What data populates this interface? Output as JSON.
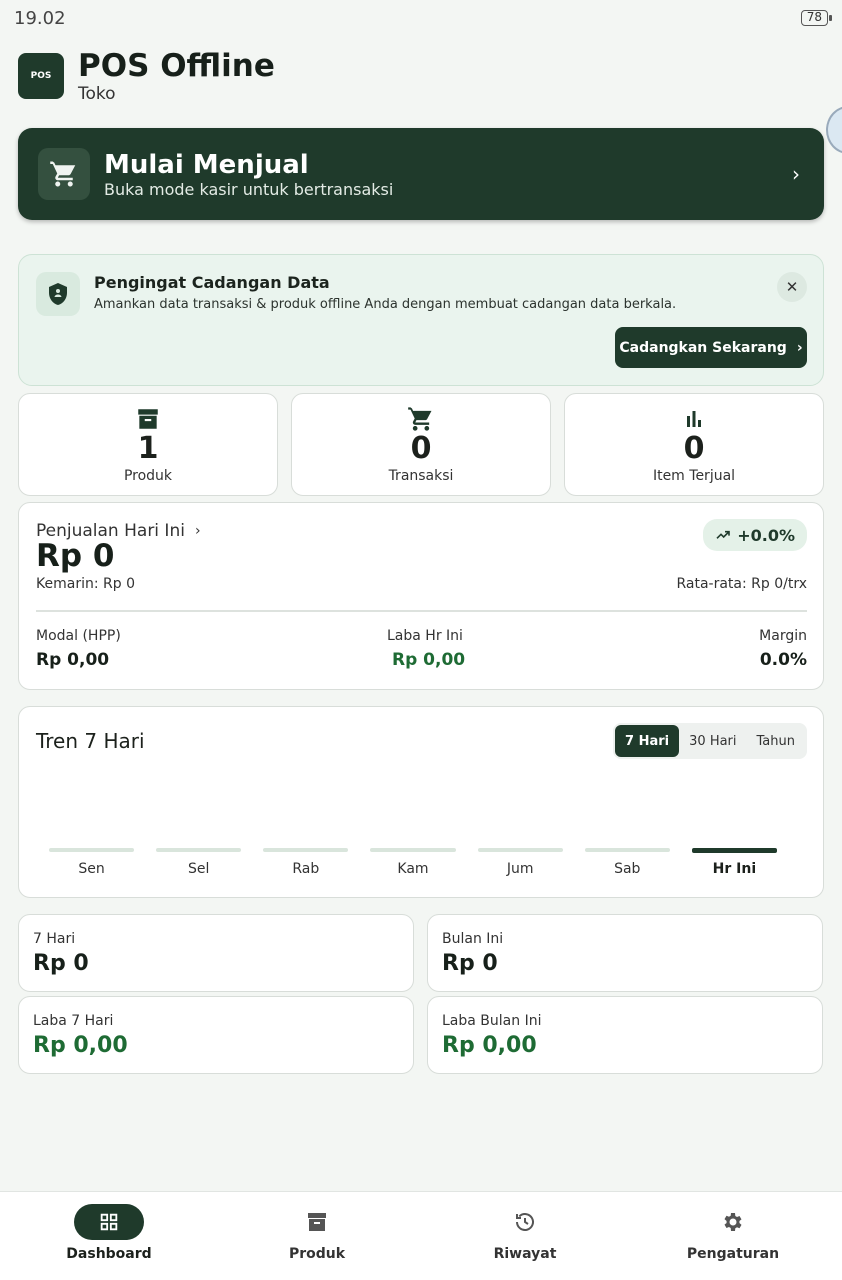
{
  "status_bar": {
    "time": "19.02",
    "battery": "78"
  },
  "app": {
    "title": "POS Offline",
    "subtitle": "Toko",
    "logo_text": "POS"
  },
  "sell_card": {
    "title": "Mulai Menjual",
    "subtitle": "Buka mode kasir untuk bertransaksi"
  },
  "backup": {
    "title": "Pengingat Cadangan Data",
    "description": "Amankan data transaksi & produk offline Anda dengan membuat cadangan data berkala.",
    "button_label": "Cadangkan Sekarang"
  },
  "stats": [
    {
      "value": "1",
      "label": "Produk",
      "icon": "archive-icon"
    },
    {
      "value": "0",
      "label": "Transaksi",
      "icon": "cart-icon"
    },
    {
      "value": "0",
      "label": "Item Terjual",
      "icon": "bar-chart-icon"
    }
  ],
  "sales_today": {
    "heading": "Penjualan Hari Ini",
    "value": "Rp 0",
    "change": "+0.0%",
    "yesterday": "Kemarin: Rp 0",
    "average": "Rata-rata: Rp 0/trx",
    "cost_label": "Modal (HPP)",
    "cost_value": "Rp 0,00",
    "profit_label": "Laba Hr Ini",
    "profit_value": "Rp 0,00",
    "margin_label": "Margin",
    "margin_value": "0.0%"
  },
  "trend": {
    "title": "Tren 7 Hari",
    "ranges": [
      "7 Hari",
      "30 Hari",
      "Tahun"
    ],
    "active_range": "7 Hari",
    "days": [
      "Sen",
      "Sel",
      "Rab",
      "Kam",
      "Jum",
      "Sab",
      "Hr Ini"
    ],
    "values": [
      0,
      0,
      0,
      0,
      0,
      0,
      0
    ]
  },
  "summary": [
    {
      "label": "7 Hari",
      "value": "Rp 0"
    },
    {
      "label": "Bulan Ini",
      "value": "Rp 0"
    },
    {
      "label": "Laba 7 Hari",
      "value": "Rp 0,00"
    },
    {
      "label": "Laba Bulan Ini",
      "value": "Rp 0,00"
    }
  ],
  "nav": [
    {
      "label": "Dashboard",
      "icon": "grid-icon"
    },
    {
      "label": "Produk",
      "icon": "archive-icon"
    },
    {
      "label": "Riwayat",
      "icon": "history-icon"
    },
    {
      "label": "Pengaturan",
      "icon": "gear-icon"
    }
  ],
  "colors": {
    "primary": "#1f3a2b",
    "profit_green": "#1e6b34",
    "background": "#f3f6f3"
  }
}
